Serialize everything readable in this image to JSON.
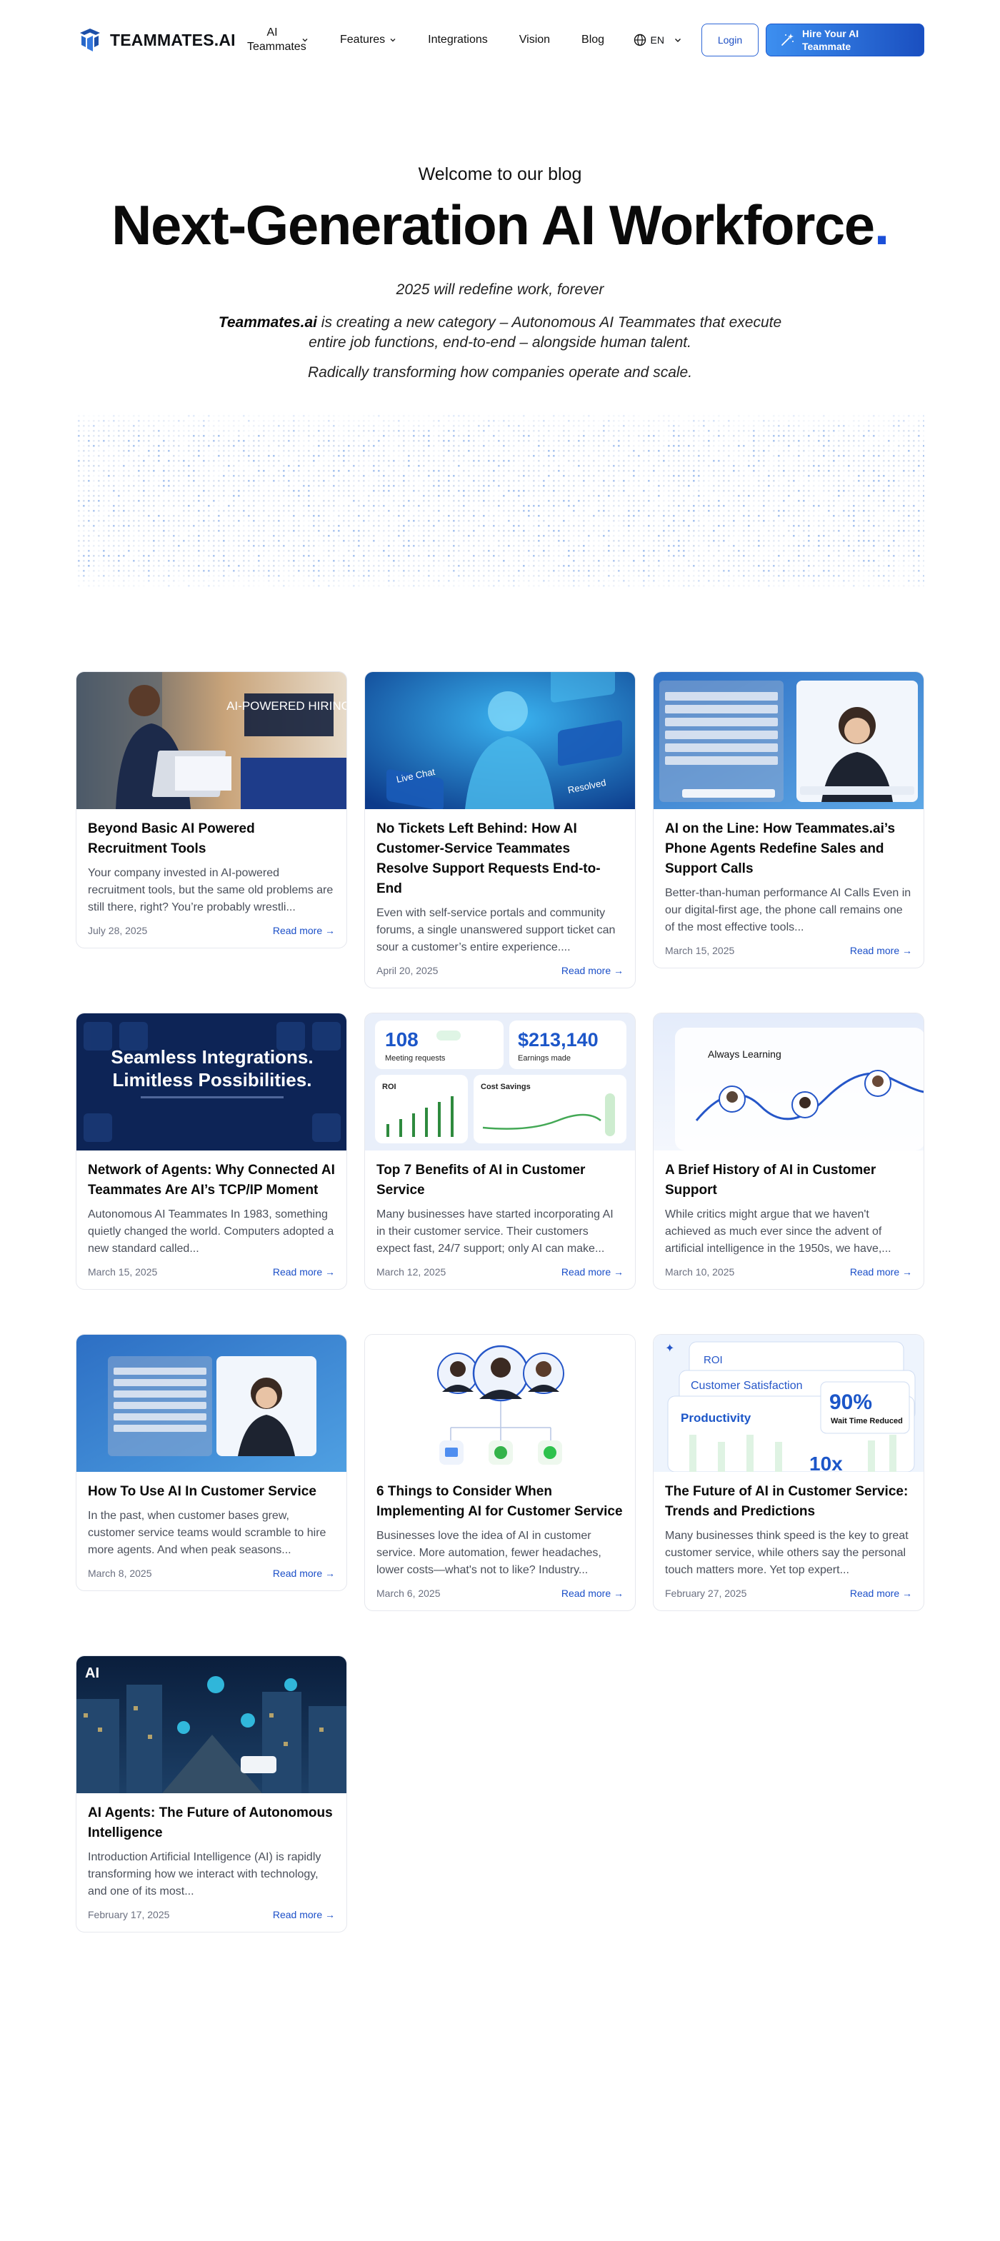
{
  "nav": {
    "brand": "TEAMMATES.AI",
    "items": [
      {
        "label": "AI Teammates",
        "dropdown": true
      },
      {
        "label": "Features",
        "dropdown": true
      },
      {
        "label": "Integrations",
        "dropdown": false
      },
      {
        "label": "Vision",
        "dropdown": false
      },
      {
        "label": "Blog",
        "dropdown": false
      }
    ],
    "language": "EN",
    "login_label": "Login",
    "hire_label": "Hire Your AI Teammate"
  },
  "hero": {
    "eyebrow": "Welcome to our blog",
    "title": "Next-Generation AI Workforce",
    "title_dot": ".",
    "tagline": "2025 will redefine work, forever",
    "desc_brand": "Teammates.ai",
    "desc_rest": " is creating a new category – Autonomous AI Teammates that execute entire job functions, end-to-end – alongside human talent.",
    "sub": "Radically transforming how companies operate and scale."
  },
  "colors": {
    "accent": "#1b4fd8",
    "link": "#1b4fc8",
    "hire_gradient_start": "#3d8ff0",
    "hire_gradient_end": "#1a4fc0"
  },
  "read_more": "Read more →",
  "posts": [
    {
      "title": "Beyond Basic AI Powered Recruitment Tools",
      "excerpt": "Your company invested in AI-powered recruitment tools, but the same old problems are still there, right? You’re probably wrestli...",
      "date": "July 28, 2025",
      "thumb_text": "AI-POWERED HIRING"
    },
    {
      "title": "No Tickets Left Behind: How AI Customer-Service Teammates Resolve Support Requests End-to-End",
      "excerpt": "Even with self-service portals and community forums, a single unanswered support ticket can sour a customer’s entire experience....",
      "date": "April 20, 2025",
      "thumb_text": [
        "Live Chat",
        "Resolved"
      ]
    },
    {
      "title": "AI on the Line: How Teammates.ai’s Phone Agents Redefine Sales and Support Calls",
      "excerpt": "Better-than-human performance AI Calls Even in our digital-first age, the phone call remains one of the most effective tools...",
      "date": "March 15, 2025",
      "thumb_text": []
    },
    {
      "title": "Network of Agents: Why Connected AI Teammates Are AI’s TCP/IP Moment",
      "excerpt": "Autonomous AI Teammates In 1983, something quietly changed the world. Computers adopted a new standard called...",
      "date": "March 15, 2025",
      "thumb_text": [
        "Seamless Integrations.",
        "Limitless Possibilities."
      ]
    },
    {
      "title": "Top 7 Benefits of AI in Customer Service",
      "excerpt": "Many businesses have started incorporating AI in their customer service. Their customers expect fast, 24/7 support; only AI can make...",
      "date": "March 12, 2025",
      "thumb_text": [
        "108",
        "Meeting requests",
        "$213,140",
        "Earnings made",
        "ROI",
        "Cost Savings"
      ]
    },
    {
      "title": "A Brief History of AI in Customer Support",
      "excerpt": "While critics might argue that we haven't achieved as much ever since the advent of artificial intelligence in the 1950s, we have,...",
      "date": "March 10, 2025",
      "thumb_text": [
        "Always Learning"
      ]
    },
    {
      "title": "How To Use AI In Customer Service",
      "excerpt": "In the past, when customer bases grew, customer service teams would scramble to hire more agents. And when peak seasons...",
      "date": "March 8, 2025",
      "thumb_text": []
    },
    {
      "title": "6 Things to Consider When Implementing AI for Customer Service",
      "excerpt": "Businesses love the idea of AI in customer service. More automation, fewer headaches, lower costs—what's not to like? Industry...",
      "date": "March 6, 2025",
      "thumb_text": []
    },
    {
      "title": "The Future of AI in Customer Service: Trends and Predictions",
      "excerpt": "Many businesses think speed is the key to great customer service, while others say the personal touch matters more. Yet top expert...",
      "date": "February 27, 2025",
      "thumb_text": [
        "ROI",
        "Customer Satisfaction",
        "Productivity",
        "90%",
        "Wait Time Reduced",
        "10x"
      ]
    },
    {
      "title": "AI Agents: The Future of Autonomous Intelligence",
      "excerpt": "Introduction Artificial Intelligence (AI) is rapidly transforming how we interact with technology, and one of its most...",
      "date": "February 17, 2025",
      "thumb_text": [
        "AI"
      ]
    }
  ]
}
